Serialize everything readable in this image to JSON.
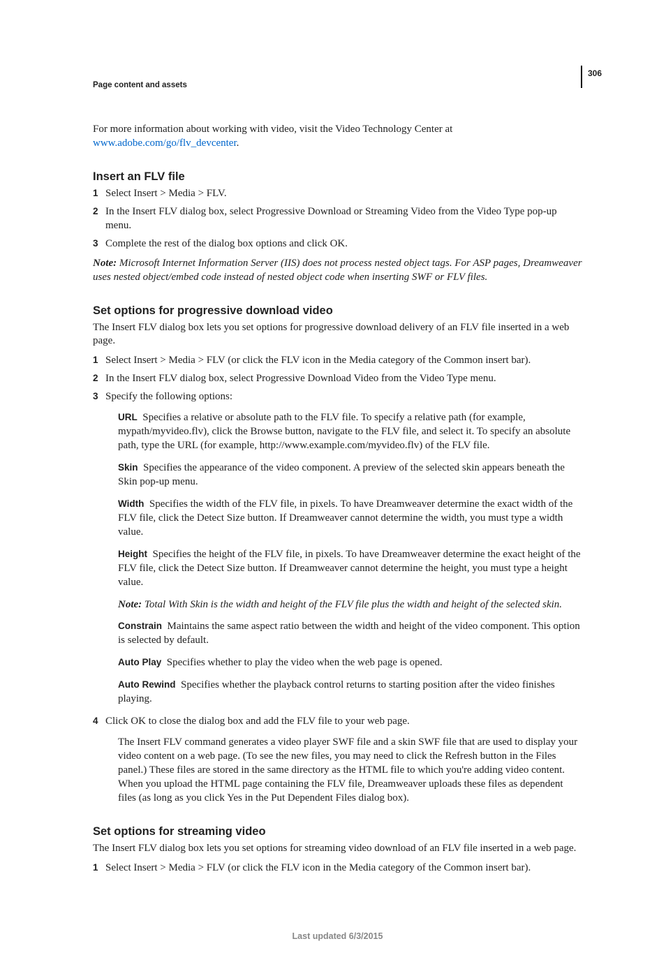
{
  "pageNumber": "306",
  "runningHead": "Page content and assets",
  "intro": {
    "text": "For more information about working with video, visit the Video Technology Center at ",
    "link": "www.adobe.com/go/flv_devcenter",
    "suffix": "."
  },
  "section1": {
    "title": "Insert an FLV file",
    "steps": [
      "Select Insert > Media > FLV.",
      "In the Insert FLV dialog box, select Progressive Download or Streaming Video from the Video Type pop-up menu.",
      "Complete the rest of the dialog box options and click OK."
    ],
    "note": {
      "label": "Note:",
      "text": " Microsoft Internet Information Server (IIS) does not process nested object tags. For ASP pages, Dreamweaver uses nested object/embed code instead of nested object code when inserting SWF or FLV files."
    }
  },
  "section2": {
    "title": "Set options for progressive download video",
    "lead": "The Insert FLV dialog box lets you set options for progressive download delivery of an FLV file inserted in a web page.",
    "steps": {
      "s1": "Select Insert > Media > FLV (or click the FLV icon in the Media category of the Common insert bar).",
      "s2": "In the Insert FLV dialog box, select Progressive Download Video from the Video Type menu.",
      "s3": "Specify the following options:",
      "s4": "Click OK to close the dialog box and add the FLV file to your web page."
    },
    "options": {
      "url": {
        "term": "URL",
        "text": "Specifies a relative or absolute path to the FLV file. To specify a relative path (for example, mypath/myvideo.flv), click the Browse button, navigate to the FLV file, and select it. To specify an absolute path, type the URL (for example, http://www.example.com/myvideo.flv) of the FLV file."
      },
      "skin": {
        "term": "Skin",
        "text": "Specifies the appearance of the video component. A preview of the selected skin appears beneath the Skin pop-up menu."
      },
      "width": {
        "term": "Width",
        "text": "Specifies the width of the FLV file, in pixels. To have Dreamweaver determine the exact width of the FLV file, click the Detect Size button. If Dreamweaver cannot determine the width, you must type a width value."
      },
      "height": {
        "term": "Height",
        "text": "Specifies the height of the FLV file, in pixels. To have Dreamweaver determine the exact height of the FLV file, click the Detect Size button. If Dreamweaver cannot determine the height, you must type a height value."
      },
      "note": {
        "label": "Note:",
        "text": " Total With Skin is the width and height of the FLV file plus the width and height of the selected skin."
      },
      "constrain": {
        "term": "Constrain",
        "text": "Maintains the same aspect ratio between the width and height of the video component. This option is selected by default."
      },
      "autoplay": {
        "term": "Auto Play",
        "text": "Specifies whether to play the video when the web page is opened."
      },
      "autorewind": {
        "term": "Auto Rewind",
        "text": "Specifies whether the playback control returns to starting position after the video finishes playing."
      }
    },
    "after4": "The Insert FLV command generates a video player SWF file and a skin SWF file that are used to display your video content on a web page. (To see the new files, you may need to click the Refresh button in the Files panel.) These files are stored in the same directory as the HTML file to which you're adding video content. When you upload the HTML page containing the FLV file, Dreamweaver uploads these files as dependent files (as long as you click Yes in the Put Dependent Files dialog box)."
  },
  "section3": {
    "title": "Set options for streaming video",
    "lead": "The Insert FLV dialog box lets you set options for streaming video download of an FLV file inserted in a web page.",
    "steps": {
      "s1": "Select Insert > Media > FLV (or click the FLV icon in the Media category of the Common insert bar)."
    }
  },
  "footer": "Last updated 6/3/2015"
}
